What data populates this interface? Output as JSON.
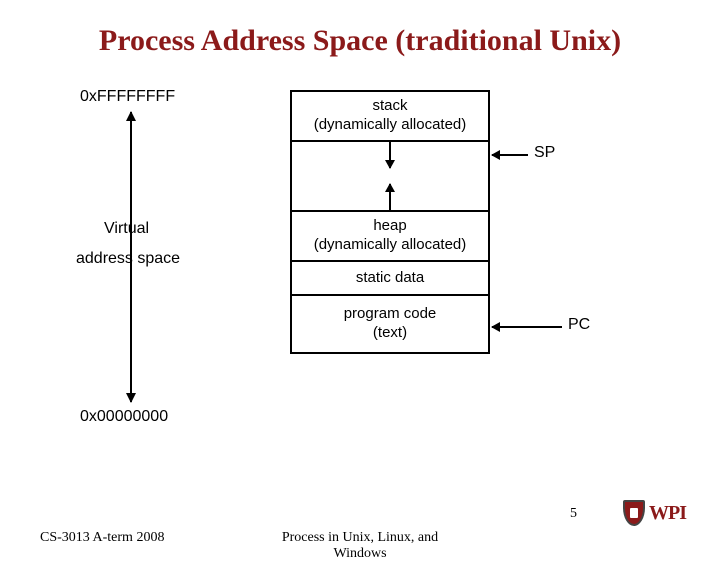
{
  "title": "Process Address Space (traditional Unix)",
  "addr": {
    "top": "0xFFFFFFFF",
    "mid1": "Virtual",
    "mid2": "address space",
    "bot": "0x00000000"
  },
  "segments": {
    "stack": {
      "l1": "stack",
      "l2": "(dynamically allocated)"
    },
    "heap": {
      "l1": "heap",
      "l2": "(dynamically allocated)"
    },
    "static": "static data",
    "text": {
      "l1": "program code",
      "l2": "(text)"
    }
  },
  "pointers": {
    "sp": "SP",
    "pc": "PC"
  },
  "footer": {
    "left": "CS-3013 A-term 2008",
    "center": "Process in Unix, Linux, and Windows",
    "number": "5",
    "logo_text": "WPI"
  }
}
